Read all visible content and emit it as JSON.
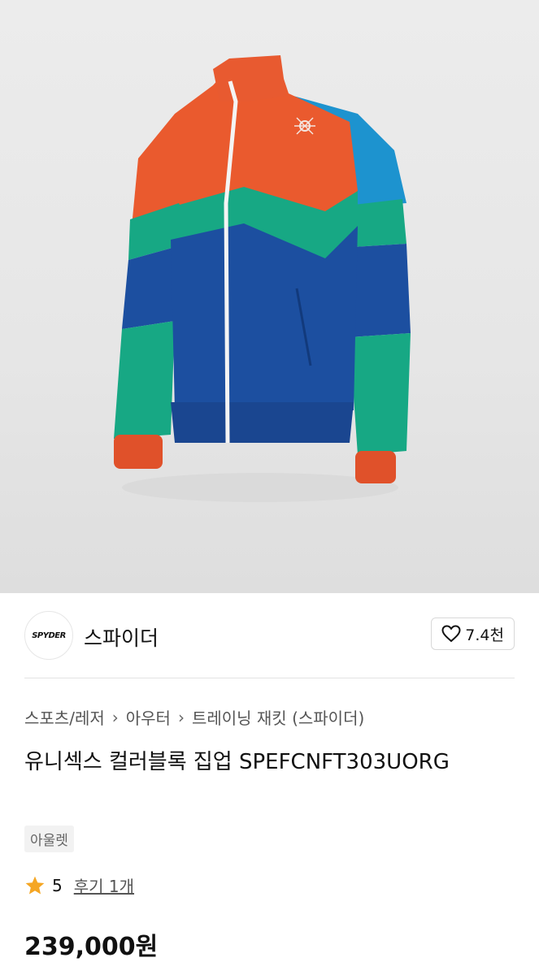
{
  "product_image": {
    "subject": "jacket",
    "colors": {
      "orange": "#ea5a2e",
      "blue": "#1c4fa0",
      "sky": "#1d93cf",
      "green": "#17a884",
      "background": "#e8e8e8"
    }
  },
  "brand": {
    "logo_text": "SPYDER",
    "name": "스파이더",
    "like_count": "7.4천"
  },
  "breadcrumb": [
    "스포츠/레저",
    "아우터",
    "트레이닝 재킷 (스파이더)"
  ],
  "product": {
    "title": "유니섹스 컬러블록 집업 SPEFCNFT303UORG",
    "badge": "아울렛",
    "rating": "5",
    "review_link": "후기 1개",
    "price": "239,000원"
  },
  "accent_colors": {
    "star": "#f5a623"
  }
}
